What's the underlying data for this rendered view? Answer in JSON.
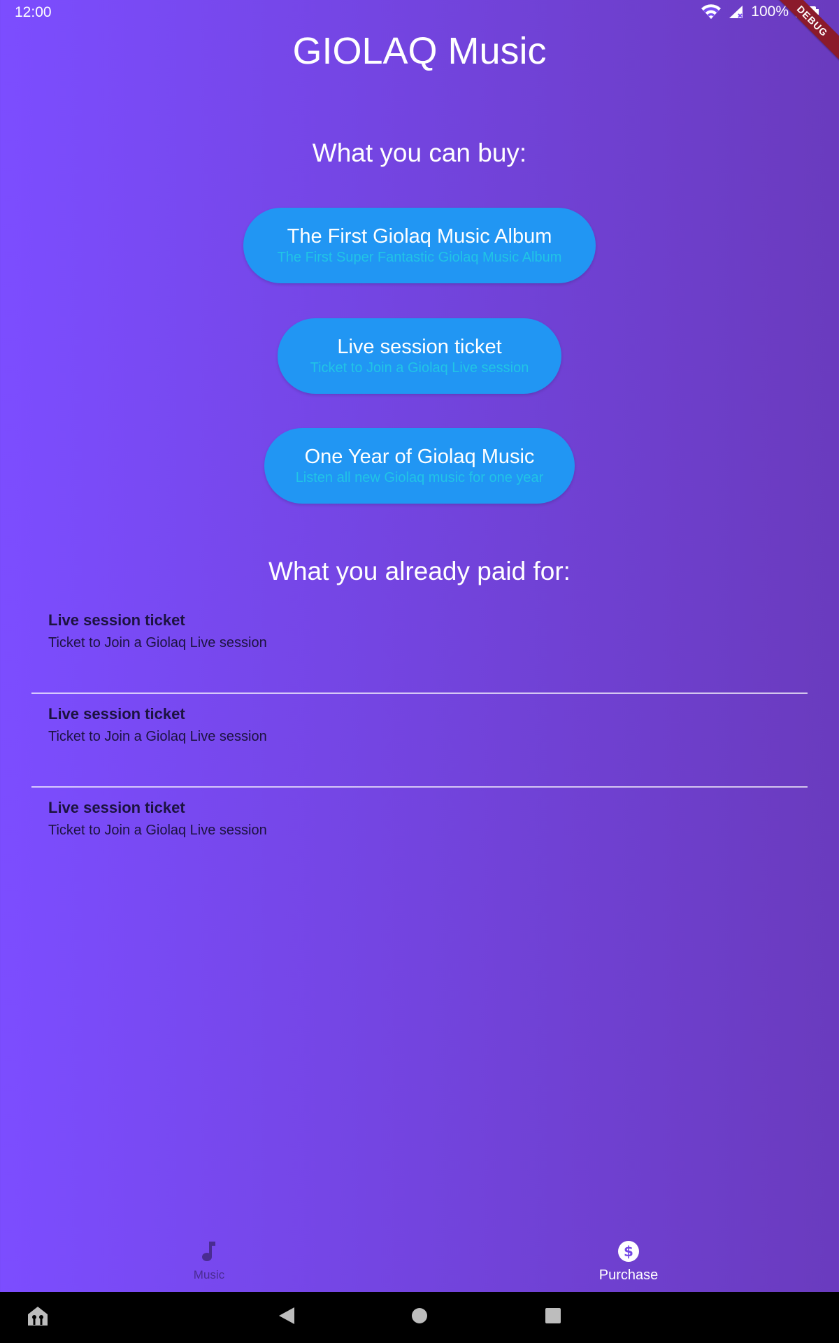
{
  "status_bar": {
    "time": "12:00",
    "battery": "100%",
    "debug_label": "DEBUG"
  },
  "app": {
    "title": "GIOLAQ Music"
  },
  "buy_section": {
    "title": "What you can buy:",
    "products": [
      {
        "title": "The First Giolaq Music Album",
        "description": "The First Super Fantastic Giolaq Music Album"
      },
      {
        "title": "Live session ticket",
        "description": "Ticket to Join a Giolaq Live session"
      },
      {
        "title": "One Year of Giolaq Music",
        "description": "Listen all new Giolaq music for one year"
      }
    ]
  },
  "paid_section": {
    "title": "What you already paid for:",
    "items": [
      {
        "title": "Live session ticket",
        "description": "Ticket to Join a Giolaq Live session"
      },
      {
        "title": "Live session ticket",
        "description": "Ticket to Join a Giolaq Live session"
      },
      {
        "title": "Live session ticket",
        "description": "Ticket to Join a Giolaq Live session"
      }
    ]
  },
  "bottom_nav": {
    "items": [
      {
        "label": "Music",
        "icon": "music-note-icon",
        "selected": false
      },
      {
        "label": "Purchase",
        "icon": "dollar-circle-icon",
        "selected": true
      }
    ]
  },
  "colors": {
    "gradient_start": "#7C4DFF",
    "gradient_end": "#6A3BBE",
    "button_bg": "#2196F3",
    "button_subtitle": "#21C4E6"
  }
}
